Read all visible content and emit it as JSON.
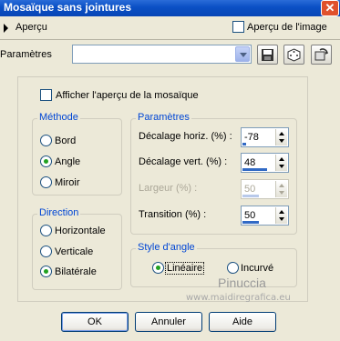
{
  "window": {
    "title": "Mosaïque sans jointures",
    "close_icon": "close-icon"
  },
  "preview": {
    "label": "Aperçu",
    "image_preview_label": "Aperçu de l'image",
    "image_preview_checked": false
  },
  "presets": {
    "label": "Paramètres",
    "selected": ""
  },
  "mosaic_preview": {
    "label": "Afficher l'aperçu de la mosaïque",
    "checked": false
  },
  "method": {
    "title": "Méthode",
    "options": [
      "Bord",
      "Angle",
      "Miroir"
    ],
    "selected": "Angle"
  },
  "direction": {
    "title": "Direction",
    "options": [
      "Horizontale",
      "Verticale",
      "Bilatérale"
    ],
    "selected": "Bilatérale"
  },
  "parameters": {
    "title": "Paramètres",
    "fields": [
      {
        "label": "Décalage horiz. (%) :",
        "value": "-78",
        "fill": 0.11,
        "enabled": true
      },
      {
        "label": "Décalage vert. (%) :",
        "value": "48",
        "fill": 0.74,
        "enabled": true
      },
      {
        "label": "Largeur (%) :",
        "value": "50",
        "fill": 0.5,
        "enabled": false
      },
      {
        "label": "Transition (%) :",
        "value": "50",
        "fill": 0.5,
        "enabled": true
      }
    ]
  },
  "corner_style": {
    "title": "Style d'angle",
    "options": [
      "Linéaire",
      "Incurvé"
    ],
    "selected": "Linéaire"
  },
  "watermark": {
    "name": "Pinuccia",
    "site": "www.maidiregrafica.eu"
  },
  "buttons": {
    "ok": "OK",
    "cancel": "Annuler",
    "help": "Aide"
  },
  "colors": {
    "titlebar": "#0a4fc4",
    "group_title": "#0046d5",
    "radio_dot": "#21a121",
    "face": "#ece9d8"
  }
}
